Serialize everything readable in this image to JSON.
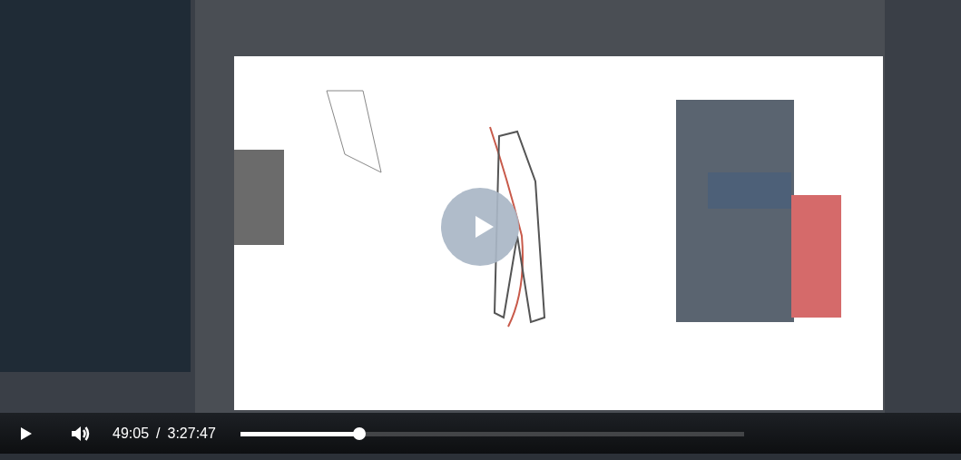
{
  "video": {
    "playing": false
  },
  "controls": {
    "current_time": "49:05",
    "separator": "/",
    "duration": "3:27:47",
    "muted": false,
    "progress": {
      "level": 0.236
    }
  }
}
